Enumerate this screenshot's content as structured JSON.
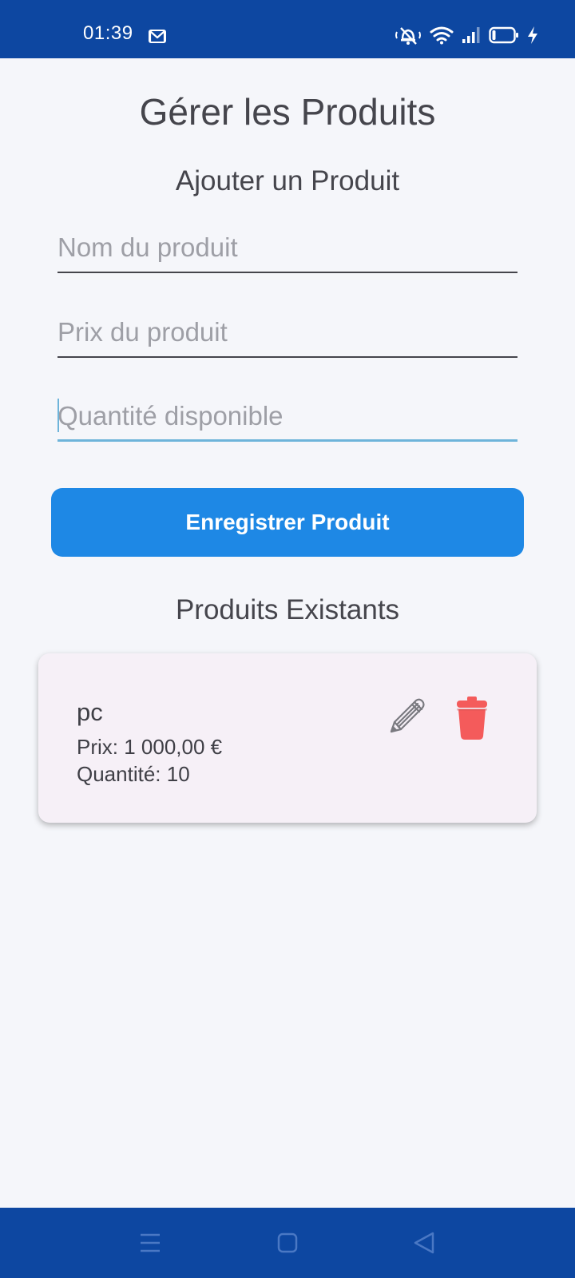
{
  "status_bar": {
    "time": "01:39",
    "icons": [
      "mail-icon",
      "mute-icon",
      "wifi-icon",
      "signal-icon",
      "battery-icon",
      "charging-icon"
    ],
    "background_color": "#0D47A1"
  },
  "header": {
    "title": "Gérer les Produits"
  },
  "form": {
    "section_title": "Ajouter un Produit",
    "name_placeholder": "Nom du produit",
    "price_placeholder": "Prix du produit",
    "quantity_placeholder": "Quantité disponible",
    "name_value": "",
    "price_value": "",
    "quantity_value": "",
    "focused_field": "quantity",
    "submit_label": "Enregistrer Produit",
    "button_color": "#1E88E5"
  },
  "products": {
    "section_title": "Produits Existants",
    "items": [
      {
        "name": "pc",
        "price_text": "Prix: 1 000,00 €",
        "quantity_text": "Quantité: 10",
        "edit_icon": "pencil-icon",
        "delete_icon": "trash-icon",
        "delete_color": "#F45B5B"
      }
    ]
  },
  "nav_bar": {
    "icons": [
      "menu-icon",
      "home-icon",
      "back-icon"
    ]
  }
}
